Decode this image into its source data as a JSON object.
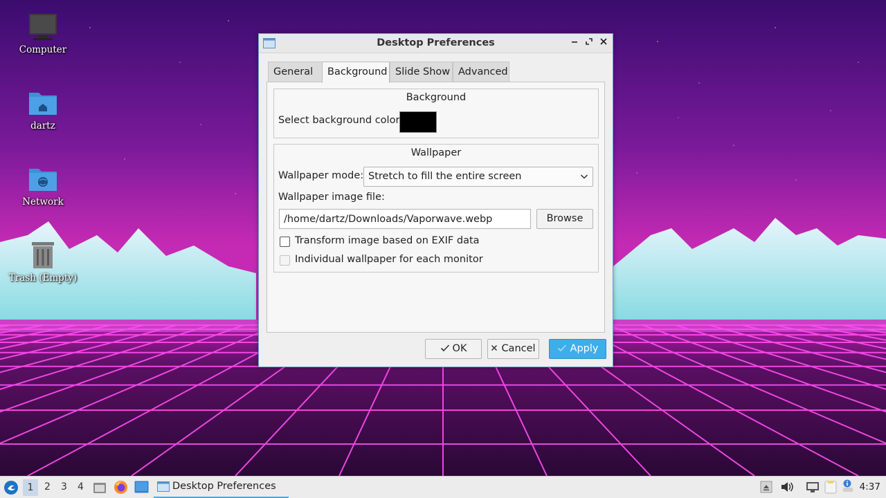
{
  "desktop": {
    "icons": [
      {
        "label": "Computer"
      },
      {
        "label": "dartz"
      },
      {
        "label": "Network"
      },
      {
        "label": "Trash  (Empty)"
      }
    ]
  },
  "dialog": {
    "title": "Desktop Preferences",
    "tabs": [
      {
        "label": "General"
      },
      {
        "label": "Background"
      },
      {
        "label": "Slide Show"
      },
      {
        "label": "Advanced"
      }
    ],
    "active_tab": "Background",
    "background_group": {
      "title": "Background",
      "color_label": "Select background color:",
      "color_value": "#000000"
    },
    "wallpaper_group": {
      "title": "Wallpaper",
      "mode_label": "Wallpaper mode:",
      "mode_value": "Stretch to fill the entire screen",
      "file_label": "Wallpaper image file:",
      "file_value": "/home/dartz/Downloads/Vaporwave.webp",
      "browse_label": "Browse",
      "exif_label": "Transform image based on EXIF data",
      "exif_checked": false,
      "per_monitor_label": "Individual wallpaper for each monitor",
      "per_monitor_checked": false,
      "per_monitor_enabled": false
    },
    "buttons": {
      "ok": "OK",
      "cancel": "Cancel",
      "apply": "Apply"
    }
  },
  "taskbar": {
    "workspaces": [
      "1",
      "2",
      "3",
      "4"
    ],
    "active_workspace": "1",
    "task_title": "Desktop Preferences",
    "clock": "4:37"
  },
  "colors": {
    "accent": "#3daee9",
    "sky_top": "#2a0a5e",
    "sky_bottom": "#b5179e",
    "grid": "#ff4df2"
  }
}
